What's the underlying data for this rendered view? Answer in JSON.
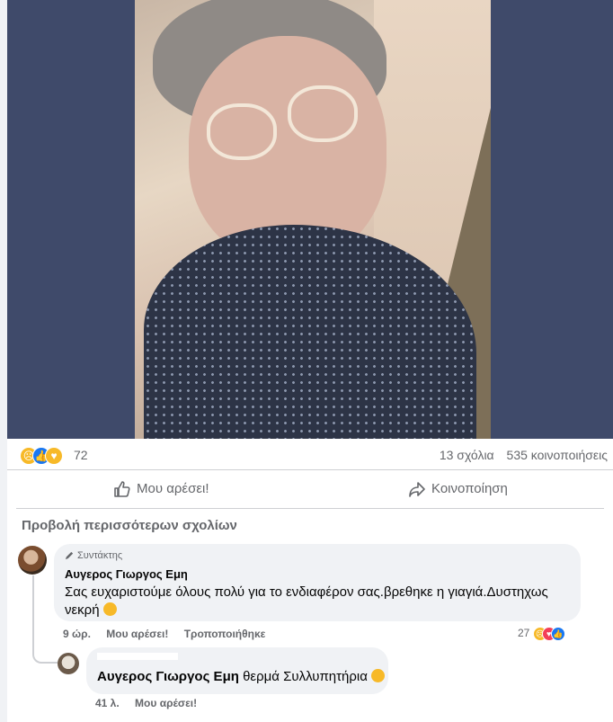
{
  "post": {
    "reactions_count": "72",
    "comments_count": "13 σχόλια",
    "shares_count": "535 κοινοποιήσεις",
    "reaction_icons": [
      "sad-icon",
      "like-icon",
      "care-icon"
    ]
  },
  "actions": {
    "like_label": "Μου αρέσει!",
    "share_label": "Κοινοποίηση"
  },
  "comments": {
    "view_more": "Προβολή περισσότερων σχολίων",
    "main": {
      "badge": "Συντάκτης",
      "author": "Αυγερος Γιωργος Εμη",
      "text": "Σας ευχαριστούμε όλους πολύ για το ενδιαφέρον σας.βρεθηκε η γιαγιά.Δυστηχως νεκρή",
      "time": "9 ώρ.",
      "like": "Μου αρέσει!",
      "edited": "Τροποποιήθηκε",
      "reaction_count": "27"
    },
    "reply": {
      "mention": "Αυγερος Γιωργος Εμη",
      "text": "θερμά Συλλυπητήρια",
      "time": "41 λ.",
      "like": "Μου αρέσει!"
    }
  },
  "colors": {
    "photo_background": "#3f4a6a",
    "meta_text": "#65676b",
    "like_blue": "#1877f2"
  }
}
